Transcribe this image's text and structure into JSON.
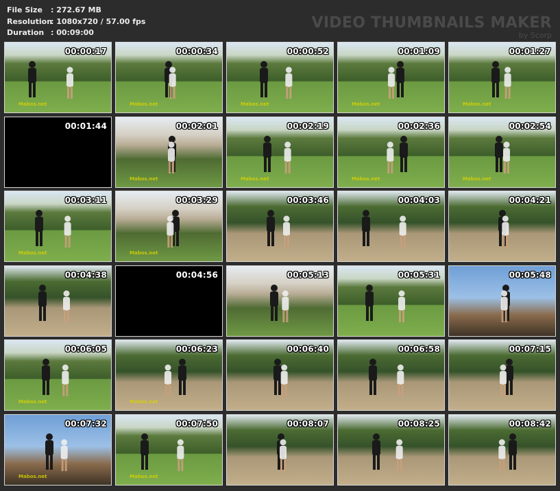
{
  "info": {
    "rows": [
      {
        "label": "File Size",
        "value": ":  272.67 MB"
      },
      {
        "label": "Resolution",
        "value": ":  1080x720 / 57.00 fps"
      },
      {
        "label": "Duration",
        "value": ":  00:09:00"
      }
    ]
  },
  "brand": {
    "title": "VIDEO THUMBNAILS MAKER",
    "subtitle": "by Scorp"
  },
  "watermark": "Mabos.net",
  "thumbnails": [
    {
      "time": "00:00:17",
      "scene": "grass",
      "watermark": true
    },
    {
      "time": "00:00:34",
      "scene": "grass",
      "watermark": true
    },
    {
      "time": "00:00:52",
      "scene": "grass",
      "watermark": true
    },
    {
      "time": "00:01:09",
      "scene": "grass",
      "watermark": true
    },
    {
      "time": "00:01:27",
      "scene": "grass",
      "watermark": true
    },
    {
      "time": "00:01:44",
      "scene": "black",
      "watermark": false
    },
    {
      "time": "00:02:01",
      "scene": "house",
      "watermark": true
    },
    {
      "time": "00:02:19",
      "scene": "grass",
      "watermark": true
    },
    {
      "time": "00:02:36",
      "scene": "grass",
      "watermark": true
    },
    {
      "time": "00:02:54",
      "scene": "grass",
      "watermark": true
    },
    {
      "time": "00:03:11",
      "scene": "grass",
      "watermark": true
    },
    {
      "time": "00:03:29",
      "scene": "house",
      "watermark": true
    },
    {
      "time": "00:03:46",
      "scene": "dirt",
      "watermark": false
    },
    {
      "time": "00:04:03",
      "scene": "dirt",
      "watermark": false
    },
    {
      "time": "00:04:21",
      "scene": "dirt",
      "watermark": false
    },
    {
      "time": "00:04:38",
      "scene": "dirt",
      "watermark": false
    },
    {
      "time": "00:04:56",
      "scene": "black",
      "watermark": false
    },
    {
      "time": "00:05:13",
      "scene": "house",
      "watermark": false
    },
    {
      "time": "00:05:31",
      "scene": "grass",
      "watermark": false
    },
    {
      "time": "00:05:48",
      "scene": "sky",
      "watermark": false
    },
    {
      "time": "00:06:05",
      "scene": "grass",
      "watermark": true
    },
    {
      "time": "00:06:23",
      "scene": "dirt",
      "watermark": true
    },
    {
      "time": "00:06:40",
      "scene": "dirt",
      "watermark": false
    },
    {
      "time": "00:06:58",
      "scene": "dirt",
      "watermark": false
    },
    {
      "time": "00:07:15",
      "scene": "dirt",
      "watermark": false
    },
    {
      "time": "00:07:32",
      "scene": "sky",
      "watermark": true
    },
    {
      "time": "00:07:50",
      "scene": "grass",
      "watermark": true
    },
    {
      "time": "00:08:07",
      "scene": "dirt",
      "watermark": false
    },
    {
      "time": "00:08:25",
      "scene": "dirt",
      "watermark": false
    },
    {
      "time": "00:08:42",
      "scene": "dirt",
      "watermark": false
    }
  ]
}
